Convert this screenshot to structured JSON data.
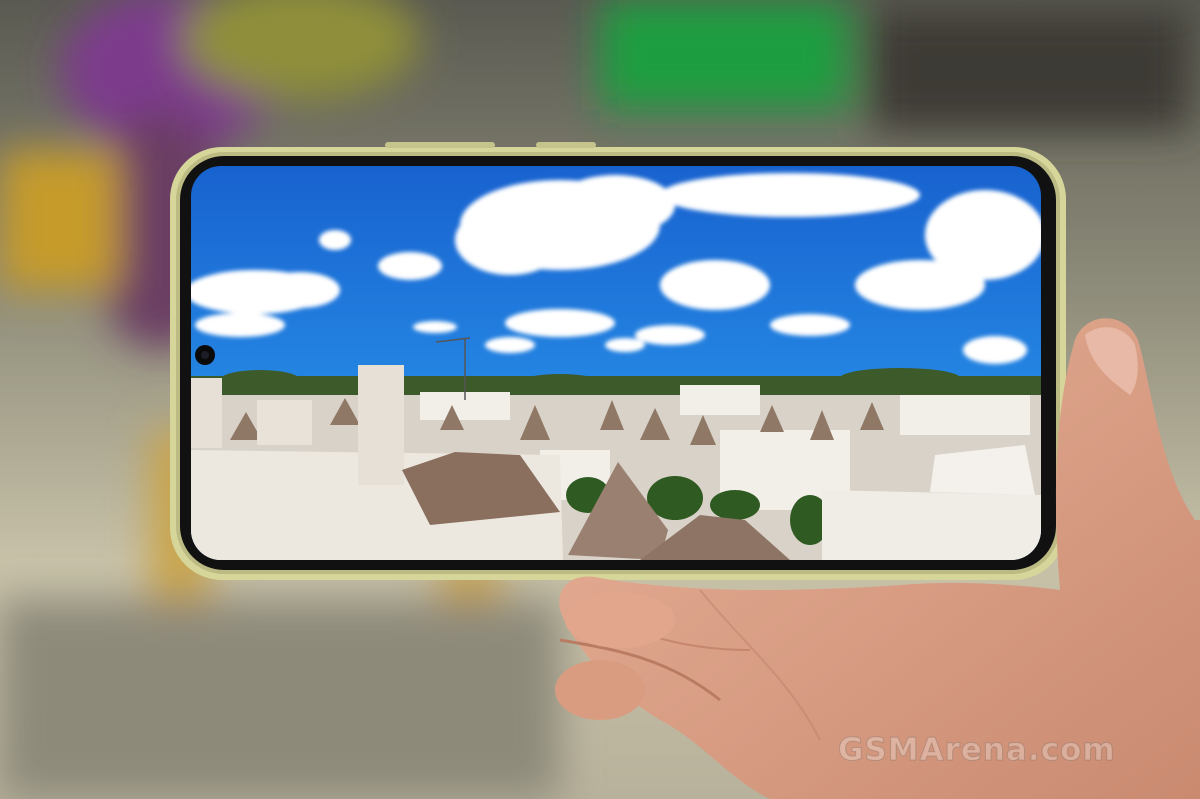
{
  "photo": {
    "subject": "phone-held-horizontally-displaying-photo",
    "watermark_text": "GSMArena.com"
  },
  "phone": {
    "frame_color": "#d7d69a",
    "screen_content": "landscape-photo"
  },
  "colors": {
    "sky_top": "#1e6fd6",
    "sky_bottom": "#2a9af0",
    "rooftop_stone": "#8f7866",
    "wall_white": "#f0ece6",
    "background_green": "#1f9e3f",
    "background_purple": "#7d3a8c",
    "skin": "#e2a68a"
  }
}
